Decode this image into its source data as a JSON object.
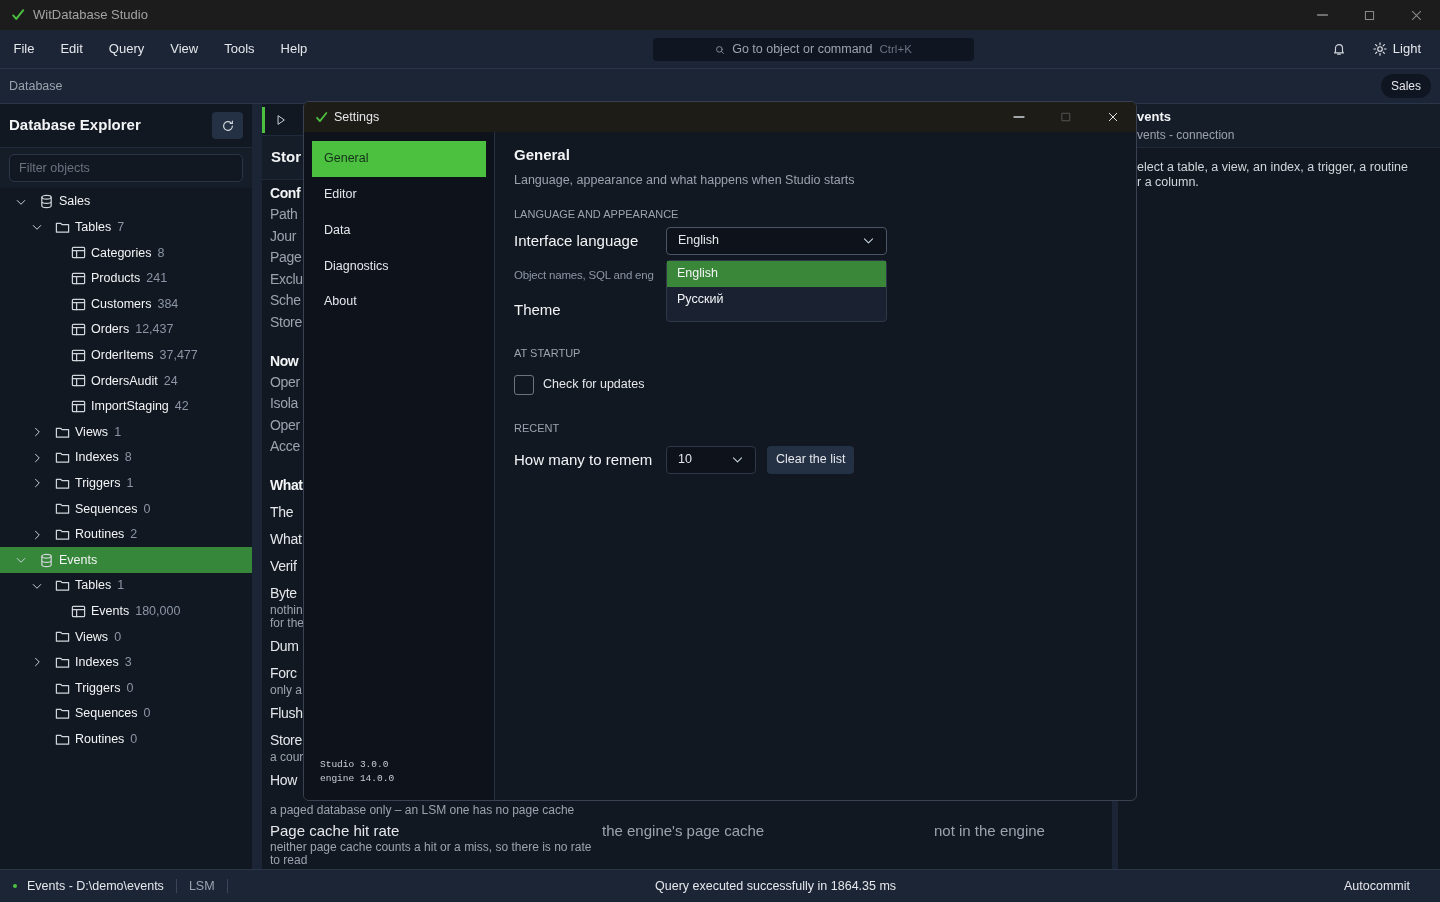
{
  "window": {
    "title": "WitDatabase Studio"
  },
  "menu": [
    "File",
    "Edit",
    "Query",
    "View",
    "Tools",
    "Help"
  ],
  "command_search": {
    "placeholder": "Go to object or command",
    "shortcut": "Ctrl+K"
  },
  "theme_toggle": {
    "label": "Light"
  },
  "breadcrumb": {
    "label": "Database",
    "connection": "Sales"
  },
  "explorer": {
    "title": "Database Explorer",
    "filter": {
      "placeholder": "Filter objects"
    },
    "tree": [
      {
        "kind": "database",
        "label": "Sales",
        "expanded": true,
        "selected": false,
        "children": [
          {
            "kind": "folder",
            "label": "Tables",
            "count": "7",
            "expanded": true,
            "children": [
              {
                "kind": "table",
                "label": "Categories",
                "count": "8"
              },
              {
                "kind": "table",
                "label": "Products",
                "count": "241"
              },
              {
                "kind": "table",
                "label": "Customers",
                "count": "384"
              },
              {
                "kind": "table",
                "label": "Orders",
                "count": "12,437"
              },
              {
                "kind": "table",
                "label": "OrderItems",
                "count": "37,477"
              },
              {
                "kind": "table",
                "label": "OrdersAudit",
                "count": "24"
              },
              {
                "kind": "table",
                "label": "ImportStaging",
                "count": "42"
              }
            ]
          },
          {
            "kind": "folder",
            "label": "Views",
            "count": "1",
            "expanded": false
          },
          {
            "kind": "folder",
            "label": "Indexes",
            "count": "8",
            "expanded": false
          },
          {
            "kind": "folder",
            "label": "Triggers",
            "count": "1",
            "expanded": false
          },
          {
            "kind": "folder",
            "label": "Sequences",
            "count": "0",
            "expanded": false,
            "empty": true
          },
          {
            "kind": "folder",
            "label": "Routines",
            "count": "2",
            "expanded": false
          }
        ]
      },
      {
        "kind": "database",
        "label": "Events",
        "expanded": true,
        "selected": true,
        "children": [
          {
            "kind": "folder",
            "label": "Tables",
            "count": "1",
            "expanded": true,
            "children": [
              {
                "kind": "table",
                "label": "Events",
                "count": "180,000"
              }
            ]
          },
          {
            "kind": "folder",
            "label": "Views",
            "count": "0",
            "expanded": false,
            "empty": true
          },
          {
            "kind": "folder",
            "label": "Indexes",
            "count": "3",
            "expanded": false
          },
          {
            "kind": "folder",
            "label": "Triggers",
            "count": "0",
            "expanded": false,
            "empty": true
          },
          {
            "kind": "folder",
            "label": "Sequences",
            "count": "0",
            "expanded": false,
            "empty": true
          },
          {
            "kind": "folder",
            "label": "Routines",
            "count": "0",
            "expanded": false,
            "empty": true
          }
        ]
      }
    ]
  },
  "document": {
    "heading": "Stor",
    "rows": [
      {
        "kind": "heading",
        "text": "Conf"
      },
      {
        "kind": "row",
        "text": "Path"
      },
      {
        "kind": "row",
        "text": "Jour"
      },
      {
        "kind": "row",
        "text": "Page"
      },
      {
        "kind": "row",
        "text": "Exclu"
      },
      {
        "kind": "row",
        "text": "Sche"
      },
      {
        "kind": "row",
        "text": "Store"
      },
      {
        "kind": "heading",
        "text": "Now"
      },
      {
        "kind": "row",
        "text": "Oper"
      },
      {
        "kind": "row",
        "text": "Isola"
      },
      {
        "kind": "row",
        "text": "Oper"
      },
      {
        "kind": "row",
        "text": "Acce"
      },
      {
        "kind": "heading",
        "text": "What"
      },
      {
        "kind": "item",
        "text": "The"
      },
      {
        "kind": "item",
        "text": "What"
      },
      {
        "kind": "item",
        "text": "Verif"
      },
      {
        "kind": "item",
        "text": "Byte",
        "note": [
          "nothin",
          "for the"
        ]
      },
      {
        "kind": "item",
        "text": "Dum"
      },
      {
        "kind": "item",
        "text": "Forc",
        "note": [
          "only a"
        ]
      },
      {
        "kind": "item",
        "text": "Flush"
      },
      {
        "kind": "item",
        "text": "Store",
        "note": [
          "a cour"
        ]
      },
      {
        "kind": "item",
        "text": "How"
      }
    ],
    "full_rows": [
      {
        "note": [
          "a paged database only – an LSM one has no page cache"
        ]
      },
      {
        "name": "Page cache hit rate",
        "note": [
          "neither page cache counts a hit or a miss, so there is no rate",
          "to read"
        ],
        "column_2": "the engine's page cache",
        "column_3": "not in the engine"
      }
    ]
  },
  "details": {
    "title": "vents",
    "subtitle": "vents - connection",
    "lines": [
      "elect a table, a view, an index, a trigger, a routine",
      "r a column."
    ]
  },
  "settings_dialog": {
    "title": "Settings",
    "nav": [
      {
        "label": "General",
        "selected": true
      },
      {
        "label": "Editor",
        "selected": false
      },
      {
        "label": "Data",
        "selected": false
      },
      {
        "label": "Diagnostics",
        "selected": false
      },
      {
        "label": "About",
        "selected": false
      }
    ],
    "version_lines": [
      "Studio 3.0.0",
      "engine 14.0.0"
    ],
    "page": {
      "title": "General",
      "subtitle": "Language, appearance and what happens when Studio starts",
      "sections": [
        {
          "heading": "LANGUAGE AND APPEARANCE",
          "items": [
            {
              "kind": "select",
              "label": "Interface language",
              "value": "English",
              "open": true,
              "options": [
                {
                  "label": "English",
                  "selected": true
                },
                {
                  "label": "Русский",
                  "selected": false
                }
              ]
            },
            {
              "kind": "hint",
              "text": "Object names, SQL and eng"
            },
            {
              "kind": "label",
              "label": "Theme"
            }
          ]
        },
        {
          "heading": "AT STARTUP",
          "items": [
            {
              "kind": "checkbox",
              "label": "Check for updates",
              "checked": false
            }
          ]
        },
        {
          "heading": "RECENT",
          "items": [
            {
              "kind": "count",
              "label": "How many to remem",
              "value": "10",
              "button": "Clear the list"
            }
          ]
        }
      ]
    }
  },
  "status_bar": {
    "connection": "Events - D:\\demo\\events",
    "engine": "LSM",
    "message": "Query executed successfully in 1864.35 ms",
    "mode": "Autocommit"
  }
}
